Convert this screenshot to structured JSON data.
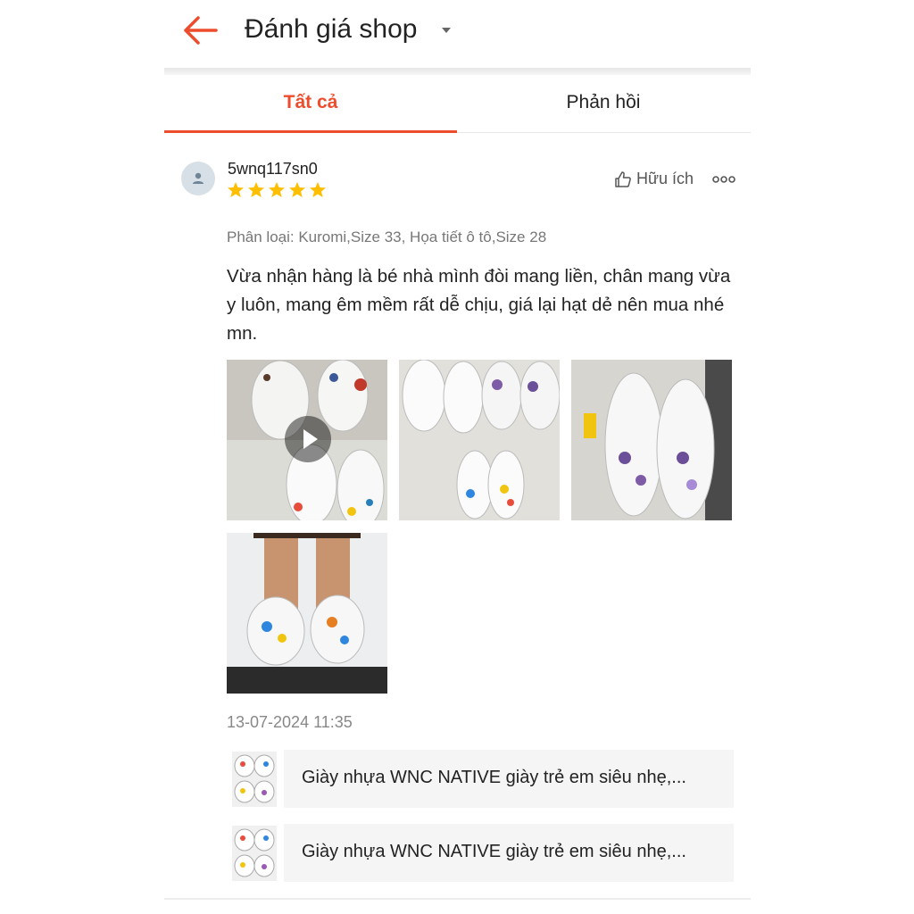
{
  "header": {
    "title": "Đánh giá shop",
    "back_icon": "arrow-left-icon",
    "dropdown_icon": "caret-down-icon",
    "accent_color": "#ee4d2d"
  },
  "tabs": [
    {
      "label": "Tất cả",
      "active": true
    },
    {
      "label": "Phản hồi",
      "active": false
    }
  ],
  "review": {
    "username": "5wnq117sn0",
    "rating": 5,
    "star_color": "#ffbf00",
    "helpful_label": "Hữu ích",
    "variant": "Phân loại: Kuromi,Size 33, Họa tiết ô tô,Size 28",
    "content": "Vừa nhận hàng là bé nhà mình đòi mang liền, chân mang vừa y luôn, mang êm mềm rất dễ chịu, giá lại hạt dẻ nên mua nhé mn.",
    "media": [
      {
        "type": "video",
        "icon": "play-icon"
      },
      {
        "type": "image"
      },
      {
        "type": "image"
      },
      {
        "type": "image"
      }
    ],
    "timestamp": "13-07-2024 11:35"
  },
  "products": [
    {
      "name": "Giày nhựa WNC NATIVE giày trẻ em siêu nhẹ,..."
    },
    {
      "name": "Giày nhựa WNC NATIVE giày trẻ em siêu nhẹ,..."
    }
  ]
}
